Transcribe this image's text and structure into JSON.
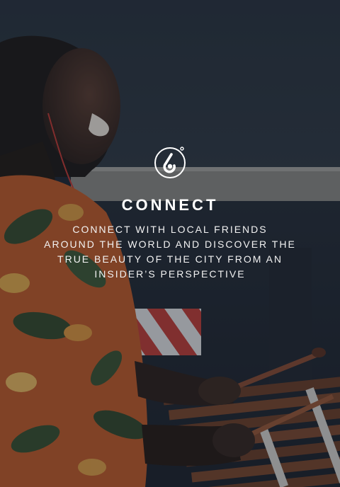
{
  "colors": {
    "text": "#ffffff",
    "overlay": "#161e2a",
    "background_dark": "#1c2430"
  },
  "logo": {
    "icon": "six-degrees-icon"
  },
  "onboarding": {
    "title": "CONNECT",
    "subtitle_lines": [
      "CONNECT WITH LOCAL FRIENDS",
      "AROUND THE WORLD AND DISCOVER THE",
      "TRUE BEAUTY OF THE CITY FROM AN",
      "INSIDER’S PERSPECTIVE"
    ]
  }
}
